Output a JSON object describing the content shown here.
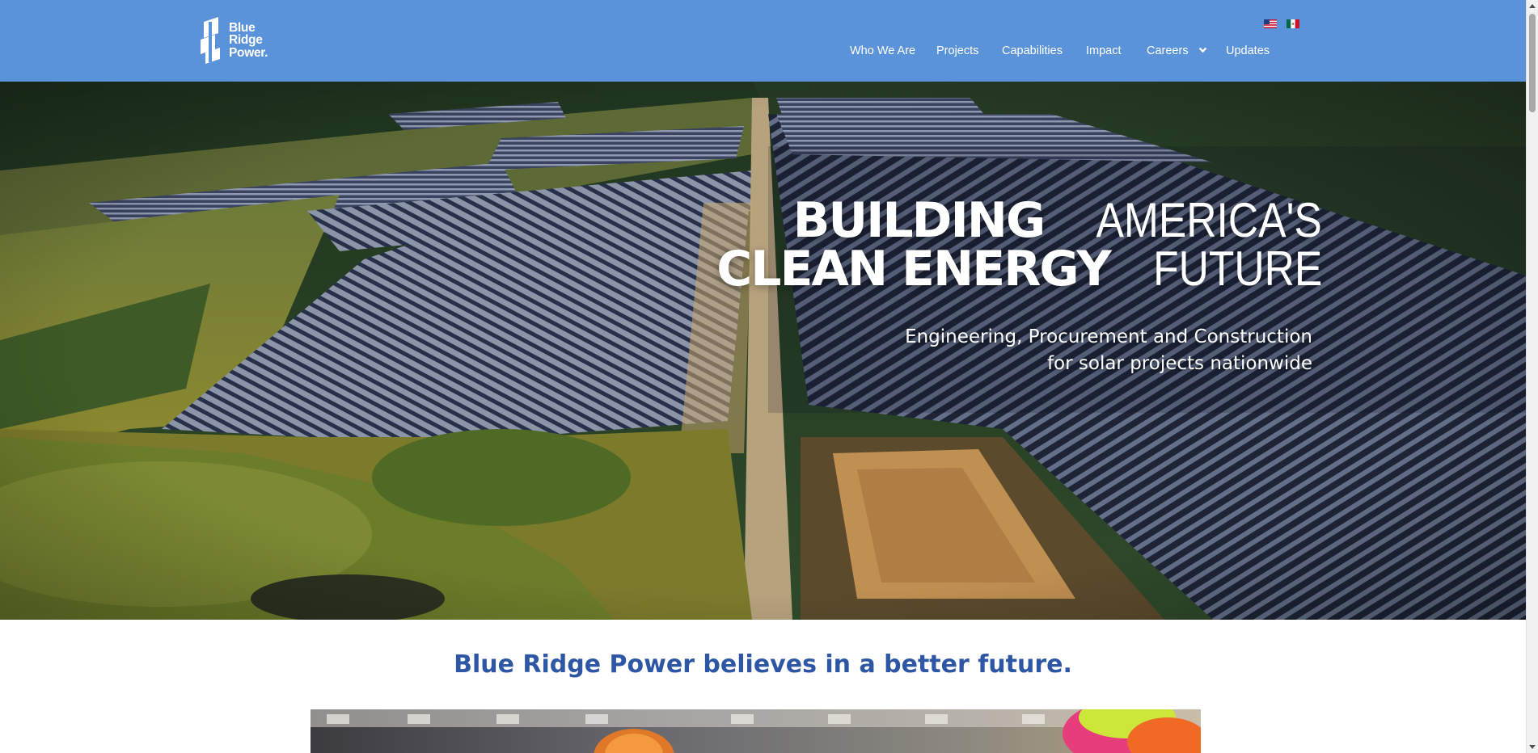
{
  "header": {
    "logo": {
      "line1": "Blue",
      "line2": "Ridge",
      "line3": "Power."
    },
    "languages": [
      {
        "icon": "us-flag-icon",
        "lang": "English"
      },
      {
        "icon": "mexico-flag-icon",
        "lang": "Español"
      }
    ],
    "nav": [
      {
        "label": "Who We Are"
      },
      {
        "label": "Projects"
      },
      {
        "label": "Capabilities"
      },
      {
        "label": "Impact"
      },
      {
        "label": "Careers",
        "icon": "chevron-down-icon"
      },
      {
        "label": "Updates"
      }
    ],
    "background_color": "#5a93d9"
  },
  "hero": {
    "title_line1_bold": "BUILDING",
    "title_line1_light": "AMERICA'S",
    "title_line2_bold": "CLEAN ENERGY",
    "title_line2_light": "FUTURE",
    "subtitle_line1": "Engineering, Procurement and Construction",
    "subtitle_line2": "for solar projects nationwide",
    "image": "aerial-solar-farm-photo"
  },
  "intro": {
    "heading": "Blue Ridge Power believes in a better future.",
    "heading_color": "#2d56a5",
    "image": "workers-in-hard-hats-photo"
  }
}
